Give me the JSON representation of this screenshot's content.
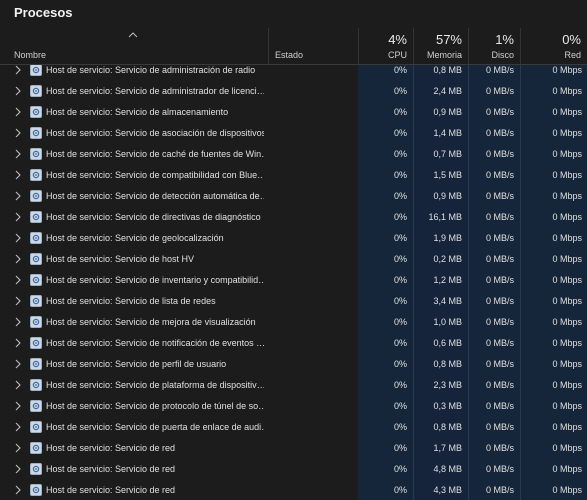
{
  "title": "Procesos",
  "columns": {
    "name": "Nombre",
    "status": "Estado",
    "cpu": {
      "pct": "4%",
      "label": "CPU"
    },
    "memory": {
      "pct": "57%",
      "label": "Memoria"
    },
    "disk": {
      "pct": "1%",
      "label": "Disco"
    },
    "network": {
      "pct": "0%",
      "label": "Red"
    }
  },
  "rows": [
    {
      "name": "Host de servicio: Servicio de administración de radio",
      "cpu": "0%",
      "mem": "0,8 MB",
      "disk": "0 MB/s",
      "net": "0 Mbps"
    },
    {
      "name": "Host de servicio: Servicio de administrador de licenci…",
      "cpu": "0%",
      "mem": "2,4 MB",
      "disk": "0 MB/s",
      "net": "0 Mbps"
    },
    {
      "name": "Host de servicio: Servicio de almacenamiento",
      "cpu": "0%",
      "mem": "0,9 MB",
      "disk": "0 MB/s",
      "net": "0 Mbps"
    },
    {
      "name": "Host de servicio: Servicio de asociación de dispositivos",
      "cpu": "0%",
      "mem": "1,4 MB",
      "disk": "0 MB/s",
      "net": "0 Mbps"
    },
    {
      "name": "Host de servicio: Servicio de caché de fuentes de Win…",
      "cpu": "0%",
      "mem": "0,7 MB",
      "disk": "0 MB/s",
      "net": "0 Mbps"
    },
    {
      "name": "Host de servicio: Servicio de compatibilidad con Blue…",
      "cpu": "0%",
      "mem": "1,5 MB",
      "disk": "0 MB/s",
      "net": "0 Mbps"
    },
    {
      "name": "Host de servicio: Servicio de detección automática de…",
      "cpu": "0%",
      "mem": "0,9 MB",
      "disk": "0 MB/s",
      "net": "0 Mbps"
    },
    {
      "name": "Host de servicio: Servicio de directivas de diagnóstico",
      "cpu": "0%",
      "mem": "16,1 MB",
      "disk": "0 MB/s",
      "net": "0 Mbps"
    },
    {
      "name": "Host de servicio: Servicio de geolocalización",
      "cpu": "0%",
      "mem": "1,9 MB",
      "disk": "0 MB/s",
      "net": "0 Mbps"
    },
    {
      "name": "Host de servicio: Servicio de host HV",
      "cpu": "0%",
      "mem": "0,2 MB",
      "disk": "0 MB/s",
      "net": "0 Mbps"
    },
    {
      "name": "Host de servicio: Servicio de inventario y compatibilid…",
      "cpu": "0%",
      "mem": "1,2 MB",
      "disk": "0 MB/s",
      "net": "0 Mbps"
    },
    {
      "name": "Host de servicio: Servicio de lista de redes",
      "cpu": "0%",
      "mem": "3,4 MB",
      "disk": "0 MB/s",
      "net": "0 Mbps"
    },
    {
      "name": "Host de servicio: Servicio de mejora de visualización",
      "cpu": "0%",
      "mem": "1,0 MB",
      "disk": "0 MB/s",
      "net": "0 Mbps"
    },
    {
      "name": "Host de servicio: Servicio de notificación de eventos …",
      "cpu": "0%",
      "mem": "0,6 MB",
      "disk": "0 MB/s",
      "net": "0 Mbps"
    },
    {
      "name": "Host de servicio: Servicio de perfil de usuario",
      "cpu": "0%",
      "mem": "0,8 MB",
      "disk": "0 MB/s",
      "net": "0 Mbps"
    },
    {
      "name": "Host de servicio: Servicio de plataforma de dispositiv…",
      "cpu": "0%",
      "mem": "2,3 MB",
      "disk": "0 MB/s",
      "net": "0 Mbps"
    },
    {
      "name": "Host de servicio: Servicio de protocolo de túnel de so…",
      "cpu": "0%",
      "mem": "0,3 MB",
      "disk": "0 MB/s",
      "net": "0 Mbps"
    },
    {
      "name": "Host de servicio: Servicio de puerta de enlace de audi…",
      "cpu": "0%",
      "mem": "0,8 MB",
      "disk": "0 MB/s",
      "net": "0 Mbps"
    },
    {
      "name": "Host de servicio: Servicio de red",
      "cpu": "0%",
      "mem": "1,7 MB",
      "disk": "0 MB/s",
      "net": "0 Mbps"
    },
    {
      "name": "Host de servicio: Servicio de red",
      "cpu": "0%",
      "mem": "4,8 MB",
      "disk": "0 MB/s",
      "net": "0 Mbps"
    },
    {
      "name": "Host de servicio: Servicio de red",
      "cpu": "0%",
      "mem": "4,3 MB",
      "disk": "0 MB/s",
      "net": "0 Mbps"
    }
  ],
  "colors": {
    "background": "#1c1c1c",
    "column_highlight": "#16263a",
    "text": "#e0e0e0"
  },
  "icons": {
    "expand": "chevron-right-icon",
    "process": "service-gear-icon",
    "sort": "sort-up-icon"
  }
}
